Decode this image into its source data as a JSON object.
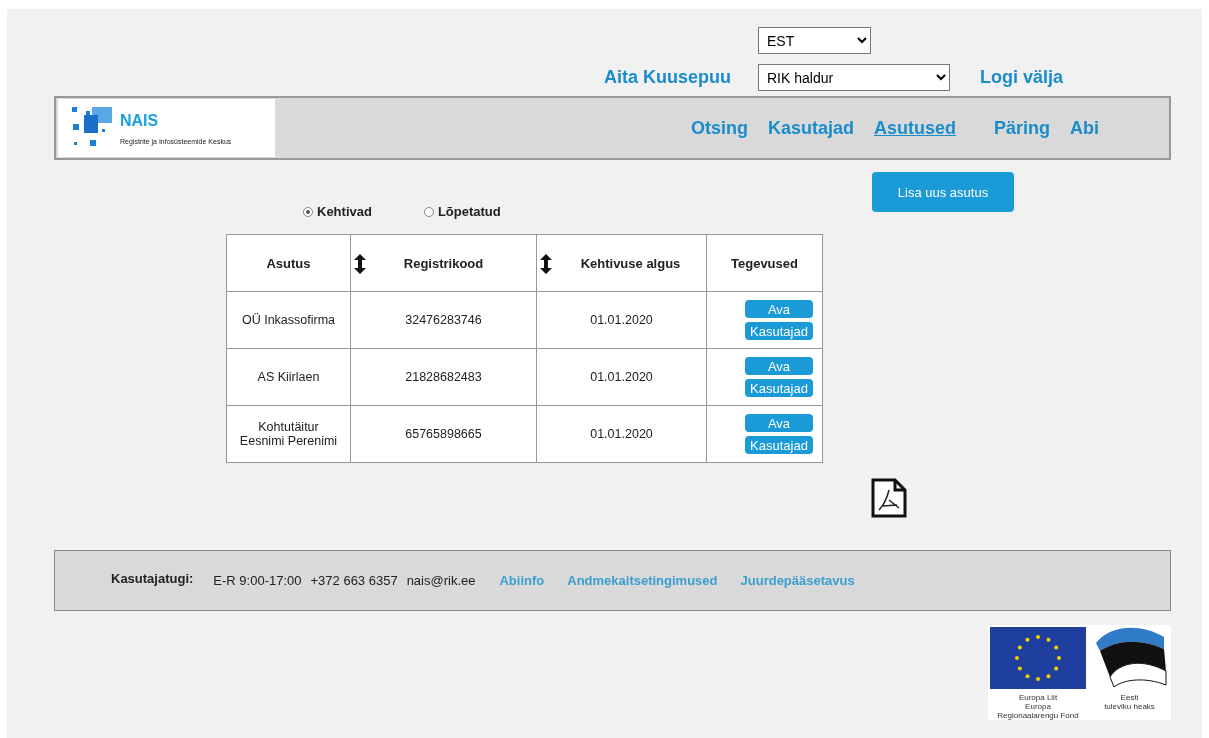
{
  "language_select": {
    "value": "EST"
  },
  "user": {
    "name": "Aita Kuusepuu"
  },
  "role_select": {
    "value": "RIK haldur"
  },
  "logout": "Logi välja",
  "logo": {
    "title": "NAIS",
    "subtitle": "Registrite ja Infosüsteemide Keskus"
  },
  "nav": [
    {
      "label": "Otsing",
      "selected": false
    },
    {
      "label": "Kasutajad",
      "selected": false
    },
    {
      "label": "Asutused",
      "selected": true
    },
    {
      "label": "Päring",
      "selected": false
    },
    {
      "label": "Abi",
      "selected": false
    }
  ],
  "add_button": "Lisa uus asutus",
  "filters": [
    {
      "label": "Kehtivad",
      "selected": true
    },
    {
      "label": "Lõpetatud",
      "selected": false
    }
  ],
  "table": {
    "columns": [
      {
        "label": "Asutus",
        "sortable": false
      },
      {
        "label": "Registrikood",
        "sortable": true
      },
      {
        "label": "Kehtivuse algus",
        "sortable": true
      },
      {
        "label": "Tegevused",
        "sortable": false
      }
    ],
    "rows": [
      {
        "cells": [
          "OÜ Inkassofirma",
          "32476283746",
          "01.01.2020"
        ],
        "actions": [
          "Ava",
          "Kasutajad"
        ]
      },
      {
        "cells": [
          "AS Kiirlaen",
          "21828682483",
          "01.01.2020"
        ],
        "actions": [
          "Ava",
          "Kasutajad"
        ]
      },
      {
        "cells": [
          "Kohtutäitur Eesnimi Perenimi",
          "65765898665",
          "01.01.2020"
        ],
        "actions": [
          "Ava",
          "Kasutajad"
        ]
      }
    ]
  },
  "footer": {
    "label": "Kasutajatugi:",
    "info": [
      "E-R 9:00-17:00",
      "+372 663 6357",
      "nais@rik.ee"
    ],
    "links": [
      "Abiinfo",
      "Andmekaitsetingimused",
      "Juurdepääsetavus"
    ]
  },
  "funding": {
    "eu_caption": [
      "Europa Liit",
      "Europa",
      "Regionaalarengu Fond"
    ],
    "ee_caption": [
      "Eesti",
      "tuleviku heaks"
    ]
  }
}
